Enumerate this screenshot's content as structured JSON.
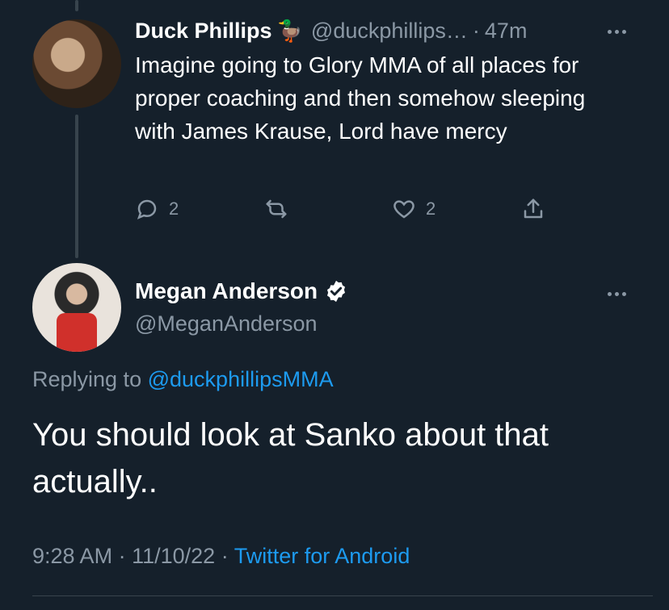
{
  "reply_parent": {
    "name": "Duck Phillips",
    "name_emoji": "🦆",
    "handle": "@duckphillips…",
    "separator": "·",
    "time": "47m",
    "text": "Imagine going to Glory MMA of all places for proper coaching and then somehow sleeping with James Krause, Lord have mercy",
    "actions": {
      "reply_count": "2",
      "retweet_count": "",
      "like_count": "2"
    }
  },
  "main_tweet": {
    "name": "Megan Anderson",
    "verified": true,
    "handle": "@MeganAnderson",
    "replying_prefix": "Replying to",
    "replying_to": "@duckphillipsMMA",
    "text": "You should look at Sanko about that actually..",
    "time": "9:28 AM",
    "date": "11/10/22",
    "separator": "·",
    "source": "Twitter for Android"
  },
  "colors": {
    "background": "#15202b",
    "text_primary": "#ffffff",
    "text_secondary": "#8b98a5",
    "link": "#1d9bf0",
    "divider": "#38444d"
  }
}
